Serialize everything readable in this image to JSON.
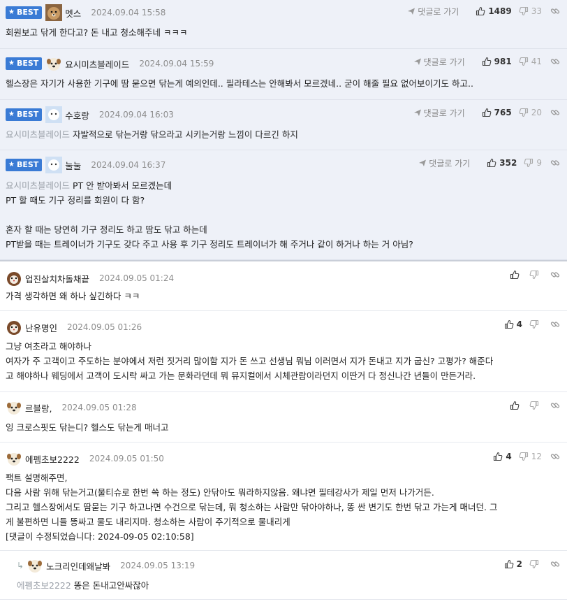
{
  "ui": {
    "reply_go": "댓글로 가기",
    "best_label": "BEST"
  },
  "colors": {
    "accent": "#3a7bd5",
    "best_bg": "#eef1f8",
    "muted": "#8d8d8d"
  },
  "comments": [
    {
      "nick": "멧스",
      "date": "2024.09.04 15:58",
      "up": "1489",
      "down": "33",
      "lines": [
        "회원보고 닦게 한다고? 돈 내고 청소해주네 ㅋㅋㅋ"
      ]
    },
    {
      "nick": "요시미츠블레이드",
      "date": "2024.09.04 15:59",
      "up": "981",
      "down": "41",
      "lines": [
        "헬스장은 자기가 사용한 기구에 땀 묻으면 닦는게 예의인데.. 필라테스는 안해봐서 모르겠네.. 굳이 해줄 필요 없어보이기도 하고.."
      ]
    },
    {
      "nick": "수호랑",
      "date": "2024.09.04 16:03",
      "up": "765",
      "down": "20",
      "mention": "요시미츠블레이드",
      "lines": [
        "자발적으로 닦는거랑 닦으라고 시키는거랑 느낌이 다르긴 하지"
      ]
    },
    {
      "nick": "눌눌",
      "date": "2024.09.04 16:37",
      "up": "352",
      "down": "9",
      "mention": "요시미츠블레이드",
      "lines": [
        "PT 안 받아봐서 모르겠는데",
        "PT 할 때도 기구 정리를 회원이 다 함?",
        "",
        "혼자 할 때는 당연히 기구 정리도 하고 땀도 닦고 하는데",
        "PT받을 때는 트레이너가 기구도 갖다 주고 사용 후 기구 정리도 트레이너가 해 주거나 같이 하거나 하는 거 아님?"
      ]
    },
    {
      "nick": "업진살치차돌채끝",
      "date": "2024.09.05 01:24",
      "up": "",
      "down": "",
      "lines": [
        "가격 생각하면 왜 하나 싶긴하다 ㅋㅋ"
      ]
    },
    {
      "nick": "난유명인",
      "date": "2024.09.05 01:26",
      "up": "4",
      "down": "",
      "lines": [
        "그냥 여초라고 해야하나",
        "여자가 주 고객이고 주도하는 분야에서 저런 짓거리 많이함 지가 돈 쓰고 선생님 뭐님 이러면서 지가 돈내고 지가 굽신? 고평가? 해준다",
        "고 해야하나 웨딩에서 고객이 도시락 싸고 가는 문화라던데 뭐 뮤지컬에서 시체관람이라던지 이딴거 다 정신나간 년들이 만든거라."
      ]
    },
    {
      "nick": "르블랑,",
      "date": "2024.09.05 01:28",
      "up": "",
      "down": "",
      "lines": [
        "잉 크로스핏도 닦는디? 헬스도 닦는게 매너고"
      ]
    },
    {
      "nick": "에펨초보2222",
      "date": "2024.09.05 01:50",
      "up": "4",
      "down": "12",
      "lines": [
        "팩트 설명해주면,",
        "다음 사람 위해 닦는거고(물티슈로 한번 쓱 하는 정도) 안닦아도 뭐라하지않음. 왜냐면 필테강사가 제일 먼저 나가거든.",
        "그리고 헬스장에서도 땀묻는 기구 하고나면 수건으로 닦는데, 뭐 청소하는 사람만 닦아야하나, 똥 싼 변기도 한번 닦고 가는게 매너던. 그",
        "게 불편하면 니들 똥싸고 물도 내리지마. 청소하는 사람이 주기적으로 물내리게",
        "[댓글이 수정되었습니다: 2024-09-05 02:10:58]"
      ]
    },
    {
      "nick": "노크리인데왜날봐",
      "date": "2024.09.05 13:19",
      "up": "2",
      "down": "",
      "mention": "에펨초보2222",
      "lines": [
        "똥은 돈내고안싸잖아"
      ]
    }
  ]
}
